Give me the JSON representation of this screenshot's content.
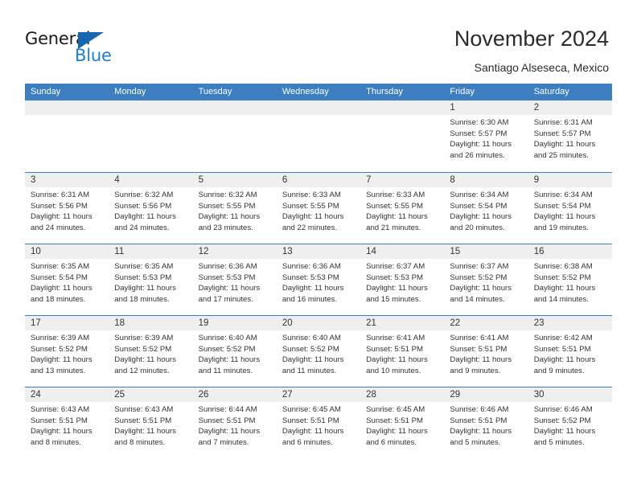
{
  "brand": {
    "name_top": "General",
    "name_bottom": "Blue",
    "accent_color": "#1c7fd4",
    "triangle_color": "#1667b0"
  },
  "header": {
    "title": "November 2024",
    "location": "Santiago Alseseca, Mexico"
  },
  "calendar": {
    "header_bg": "#3c7ebf",
    "daynumber_bg": "#efefef",
    "weekdays": [
      "Sunday",
      "Monday",
      "Tuesday",
      "Wednesday",
      "Thursday",
      "Friday",
      "Saturday"
    ],
    "weeks": [
      [
        {
          "day": "",
          "blank": true
        },
        {
          "day": "",
          "blank": true
        },
        {
          "day": "",
          "blank": true
        },
        {
          "day": "",
          "blank": true
        },
        {
          "day": "",
          "blank": true
        },
        {
          "day": "1",
          "sunrise": "Sunrise: 6:30 AM",
          "sunset": "Sunset: 5:57 PM",
          "daylight1": "Daylight: 11 hours",
          "daylight2": "and 26 minutes."
        },
        {
          "day": "2",
          "sunrise": "Sunrise: 6:31 AM",
          "sunset": "Sunset: 5:57 PM",
          "daylight1": "Daylight: 11 hours",
          "daylight2": "and 25 minutes."
        }
      ],
      [
        {
          "day": "3",
          "sunrise": "Sunrise: 6:31 AM",
          "sunset": "Sunset: 5:56 PM",
          "daylight1": "Daylight: 11 hours",
          "daylight2": "and 24 minutes."
        },
        {
          "day": "4",
          "sunrise": "Sunrise: 6:32 AM",
          "sunset": "Sunset: 5:56 PM",
          "daylight1": "Daylight: 11 hours",
          "daylight2": "and 24 minutes."
        },
        {
          "day": "5",
          "sunrise": "Sunrise: 6:32 AM",
          "sunset": "Sunset: 5:55 PM",
          "daylight1": "Daylight: 11 hours",
          "daylight2": "and 23 minutes."
        },
        {
          "day": "6",
          "sunrise": "Sunrise: 6:33 AM",
          "sunset": "Sunset: 5:55 PM",
          "daylight1": "Daylight: 11 hours",
          "daylight2": "and 22 minutes."
        },
        {
          "day": "7",
          "sunrise": "Sunrise: 6:33 AM",
          "sunset": "Sunset: 5:55 PM",
          "daylight1": "Daylight: 11 hours",
          "daylight2": "and 21 minutes."
        },
        {
          "day": "8",
          "sunrise": "Sunrise: 6:34 AM",
          "sunset": "Sunset: 5:54 PM",
          "daylight1": "Daylight: 11 hours",
          "daylight2": "and 20 minutes."
        },
        {
          "day": "9",
          "sunrise": "Sunrise: 6:34 AM",
          "sunset": "Sunset: 5:54 PM",
          "daylight1": "Daylight: 11 hours",
          "daylight2": "and 19 minutes."
        }
      ],
      [
        {
          "day": "10",
          "sunrise": "Sunrise: 6:35 AM",
          "sunset": "Sunset: 5:54 PM",
          "daylight1": "Daylight: 11 hours",
          "daylight2": "and 18 minutes."
        },
        {
          "day": "11",
          "sunrise": "Sunrise: 6:35 AM",
          "sunset": "Sunset: 5:53 PM",
          "daylight1": "Daylight: 11 hours",
          "daylight2": "and 18 minutes."
        },
        {
          "day": "12",
          "sunrise": "Sunrise: 6:36 AM",
          "sunset": "Sunset: 5:53 PM",
          "daylight1": "Daylight: 11 hours",
          "daylight2": "and 17 minutes."
        },
        {
          "day": "13",
          "sunrise": "Sunrise: 6:36 AM",
          "sunset": "Sunset: 5:53 PM",
          "daylight1": "Daylight: 11 hours",
          "daylight2": "and 16 minutes."
        },
        {
          "day": "14",
          "sunrise": "Sunrise: 6:37 AM",
          "sunset": "Sunset: 5:53 PM",
          "daylight1": "Daylight: 11 hours",
          "daylight2": "and 15 minutes."
        },
        {
          "day": "15",
          "sunrise": "Sunrise: 6:37 AM",
          "sunset": "Sunset: 5:52 PM",
          "daylight1": "Daylight: 11 hours",
          "daylight2": "and 14 minutes."
        },
        {
          "day": "16",
          "sunrise": "Sunrise: 6:38 AM",
          "sunset": "Sunset: 5:52 PM",
          "daylight1": "Daylight: 11 hours",
          "daylight2": "and 14 minutes."
        }
      ],
      [
        {
          "day": "17",
          "sunrise": "Sunrise: 6:39 AM",
          "sunset": "Sunset: 5:52 PM",
          "daylight1": "Daylight: 11 hours",
          "daylight2": "and 13 minutes."
        },
        {
          "day": "18",
          "sunrise": "Sunrise: 6:39 AM",
          "sunset": "Sunset: 5:52 PM",
          "daylight1": "Daylight: 11 hours",
          "daylight2": "and 12 minutes."
        },
        {
          "day": "19",
          "sunrise": "Sunrise: 6:40 AM",
          "sunset": "Sunset: 5:52 PM",
          "daylight1": "Daylight: 11 hours",
          "daylight2": "and 11 minutes."
        },
        {
          "day": "20",
          "sunrise": "Sunrise: 6:40 AM",
          "sunset": "Sunset: 5:52 PM",
          "daylight1": "Daylight: 11 hours",
          "daylight2": "and 11 minutes."
        },
        {
          "day": "21",
          "sunrise": "Sunrise: 6:41 AM",
          "sunset": "Sunset: 5:51 PM",
          "daylight1": "Daylight: 11 hours",
          "daylight2": "and 10 minutes."
        },
        {
          "day": "22",
          "sunrise": "Sunrise: 6:41 AM",
          "sunset": "Sunset: 5:51 PM",
          "daylight1": "Daylight: 11 hours",
          "daylight2": "and 9 minutes."
        },
        {
          "day": "23",
          "sunrise": "Sunrise: 6:42 AM",
          "sunset": "Sunset: 5:51 PM",
          "daylight1": "Daylight: 11 hours",
          "daylight2": "and 9 minutes."
        }
      ],
      [
        {
          "day": "24",
          "sunrise": "Sunrise: 6:43 AM",
          "sunset": "Sunset: 5:51 PM",
          "daylight1": "Daylight: 11 hours",
          "daylight2": "and 8 minutes."
        },
        {
          "day": "25",
          "sunrise": "Sunrise: 6:43 AM",
          "sunset": "Sunset: 5:51 PM",
          "daylight1": "Daylight: 11 hours",
          "daylight2": "and 8 minutes."
        },
        {
          "day": "26",
          "sunrise": "Sunrise: 6:44 AM",
          "sunset": "Sunset: 5:51 PM",
          "daylight1": "Daylight: 11 hours",
          "daylight2": "and 7 minutes."
        },
        {
          "day": "27",
          "sunrise": "Sunrise: 6:45 AM",
          "sunset": "Sunset: 5:51 PM",
          "daylight1": "Daylight: 11 hours",
          "daylight2": "and 6 minutes."
        },
        {
          "day": "28",
          "sunrise": "Sunrise: 6:45 AM",
          "sunset": "Sunset: 5:51 PM",
          "daylight1": "Daylight: 11 hours",
          "daylight2": "and 6 minutes."
        },
        {
          "day": "29",
          "sunrise": "Sunrise: 6:46 AM",
          "sunset": "Sunset: 5:51 PM",
          "daylight1": "Daylight: 11 hours",
          "daylight2": "and 5 minutes."
        },
        {
          "day": "30",
          "sunrise": "Sunrise: 6:46 AM",
          "sunset": "Sunset: 5:52 PM",
          "daylight1": "Daylight: 11 hours",
          "daylight2": "and 5 minutes."
        }
      ]
    ]
  }
}
